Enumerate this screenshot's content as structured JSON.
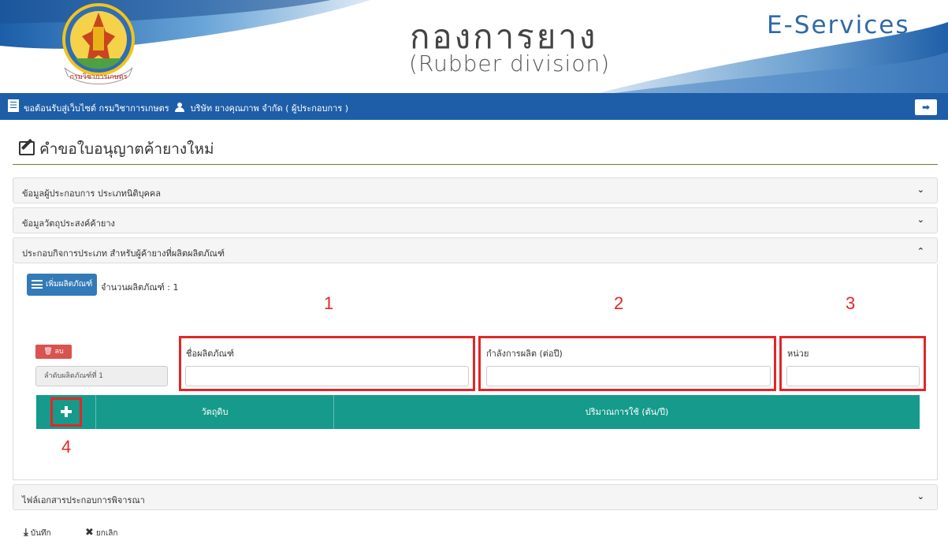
{
  "header": {
    "org_logo_text": "กรมวิชาการเกษตร",
    "title_thai": "กองการยาง",
    "title_en": "(Rubber division)",
    "eservices": "E-Services"
  },
  "navbar": {
    "menu_icon": "menu-icon",
    "welcome": "ขอต้อนรับสู่เว็บไซต์ กรมวิชาการเกษตร",
    "user": "บริษัท ยางคุณภาพ จำกัด ( ผู้ประกอบการ )",
    "logout_icon": "logout-icon"
  },
  "page": {
    "title": "คำขอใบอนุญาตค้ายางใหม่"
  },
  "panels": [
    {
      "title": "ข้อมูลผู้ประกอบการ  ประเภทนิติบุคคล",
      "state": "collapsed"
    },
    {
      "title": "ข้อมูลวัตถุประสงค์ค้ายาง",
      "state": "collapsed"
    },
    {
      "title": "ประกอบกิจการประเภท  สำหรับผู้ค้ายางที่ผลิตผลิตภัณฑ์",
      "state": "expanded"
    },
    {
      "title": "ไฟล์เอกสารประกอบการพิจารณา",
      "state": "collapsed"
    }
  ],
  "product_section": {
    "add_button": "เพิ่มผลิตภัณฑ์",
    "count_label": "จำนวนผลิตภัณฑ์ : 1",
    "delete_button": "ลบ",
    "sequence": "ลำดับผลิตภัณฑ์ที่ 1",
    "fields": {
      "product_name_label": "ชื่อผลิตภัณฑ์",
      "product_name_value": "",
      "capacity_label": "กำลังการผลิต (ต่อปี)",
      "capacity_value": "",
      "unit_label": "หน่วย",
      "unit_value": ""
    },
    "materials_table": {
      "columns": [
        "วัตถุดิบ",
        "ปริมาณการใช้ (ตัน/ปี)"
      ]
    }
  },
  "annotations": [
    "1",
    "2",
    "3",
    "4"
  ],
  "footer": {
    "save": "บันทึก",
    "cancel": "ยกเลิก"
  },
  "colors": {
    "nav_blue": "#1e5ea8",
    "button_blue": "#337ab7",
    "table_teal": "#159a8c",
    "annotation_red": "#e32626",
    "danger_red": "#d9534f"
  }
}
